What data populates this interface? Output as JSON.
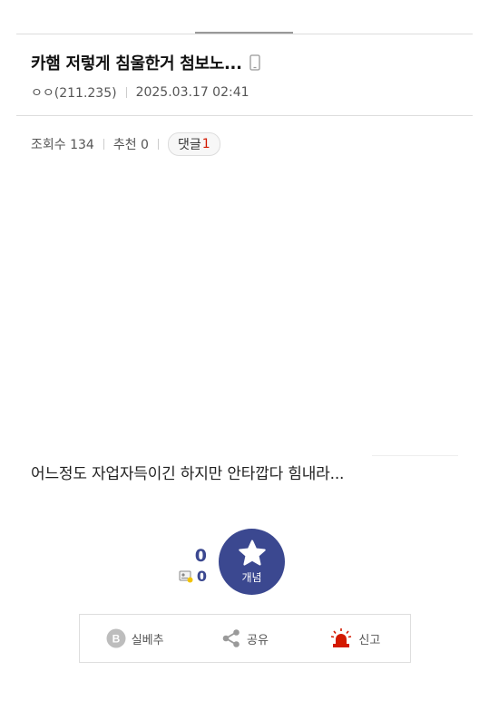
{
  "post": {
    "title": "카햄 저렇게 침울한거 첨보노...",
    "author": "ㅇㅇ(211.235)",
    "datetime": "2025.03.17 02:41",
    "views_label": "조회수 134",
    "recommend_label": "추천 0",
    "comments_label": "댓글",
    "comments_count": "1",
    "body": "어느정도 자업자득이긴 하지만 안타깝다 힘내라..."
  },
  "vote": {
    "count": "0",
    "fixed_count": "0",
    "button_label": "개념",
    "accent_color": "#3b4890"
  },
  "actions": {
    "downvote_label": "실베추",
    "share_label": "공유",
    "report_label": "신고",
    "report_color": "#d31900"
  }
}
